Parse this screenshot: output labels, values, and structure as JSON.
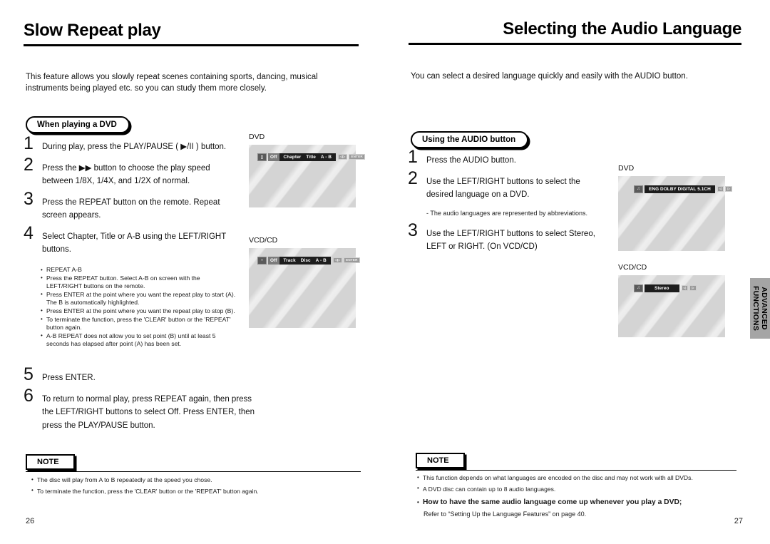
{
  "left_page": {
    "title": "Slow Repeat play",
    "intro": "This feature allows you slowly repeat scenes containing sports, dancing, musical instruments being played etc. so you can study them more closely.",
    "section_label": "When playing a DVD",
    "steps": [
      {
        "num": "1",
        "text": "During play, press the PLAY/PAUSE ( ▶/II ) button."
      },
      {
        "num": "2",
        "text": "Press the ▶▶ button to choose the play speed between 1/8X, 1/4X, and 1/2X of normal."
      },
      {
        "num": "3",
        "text": "Press the REPEAT button on the remote. Repeat screen appears."
      },
      {
        "num": "4",
        "text": "Select Chapter, Title or A-B using the LEFT/RIGHT buttons."
      }
    ],
    "bullets": [
      "REPEAT A-B",
      "Press the REPEAT button. Select A-B on screen with the LEFT/RIGHT buttons on the remote.",
      "Press ENTER at the point where you want the repeat play to start (A). The B is automatically highlighted.",
      "Press ENTER at the point where you want the repeat play to stop (B).",
      "To terminate the function, press the 'CLEAR' button or the 'REPEAT' button again.",
      "A-B REPEAT does not allow you to set point (B) until at least 5 seconds has elapsed after point (A) has been set."
    ],
    "steps_tail": [
      {
        "num": "5",
        "text": "Press ENTER."
      },
      {
        "num": "6",
        "text": "To return to normal play, press REPEAT again, then press the LEFT/RIGHT buttons to select Off. Press ENTER, then press the PLAY/PAUSE button."
      }
    ],
    "note_label": "NOTE",
    "note_items": [
      "The disc will play from A to B repeatedly at the speed you chose.",
      "To terminate the function, press the 'CLEAR' button or the 'REPEAT' button again."
    ],
    "screens": [
      {
        "label": "DVD",
        "osd": {
          "icon": "tv-icon",
          "off": "Off",
          "items": [
            "Chapter",
            "Title",
            "A - B"
          ],
          "chips": [
            "◁▷",
            "ENTER"
          ]
        }
      },
      {
        "label": "VCD/CD",
        "osd": {
          "icon": "disc-icon",
          "off": "Off",
          "items": [
            "Track",
            "Disc",
            "A - B"
          ],
          "chips": [
            "◁▷",
            "ENTER"
          ]
        }
      }
    ],
    "page_number": "26"
  },
  "right_page": {
    "title": "Selecting the Audio Language",
    "intro": "You can select a desired language quickly and easily with the AUDIO button.",
    "section_label": "Using the AUDIO button",
    "steps": [
      {
        "num": "1",
        "text": "Press the AUDIO button."
      },
      {
        "num": "2",
        "text": "Use the LEFT/RIGHT buttons to select the desired language on a DVD."
      }
    ],
    "step2_note": "- The audio languages are represented by abbreviations.",
    "steps_tail": [
      {
        "num": "3",
        "text": "Use the LEFT/RIGHT buttons to select Stereo, LEFT or RIGHT. (On VCD/CD)"
      }
    ],
    "note_label": "NOTE",
    "note_items": [
      "This function depends on what languages are encoded on the disc and may not work with all DVDs.",
      "A DVD disc can contain up to 8 audio languages."
    ],
    "note_bold": "How to have the same audio language come up whenever you play  a DVD;",
    "note_sub": "Refer to “Setting Up the Language Features” on page 40.",
    "screens": [
      {
        "label": "DVD",
        "osd": {
          "icon": "audio-icon",
          "items": [
            "ENG  DOLBY DIGITAL  5.1CH"
          ],
          "chips": [
            "◁",
            "▷"
          ]
        }
      },
      {
        "label": "VCD/CD",
        "osd": {
          "icon": "audio-icon",
          "items": [
            "Stereo"
          ],
          "chips": [
            "◁",
            "▷"
          ]
        }
      }
    ],
    "page_number": "27"
  },
  "side_tab": {
    "line1": "ADVANCED",
    "line2": "FUNCTIONS"
  }
}
